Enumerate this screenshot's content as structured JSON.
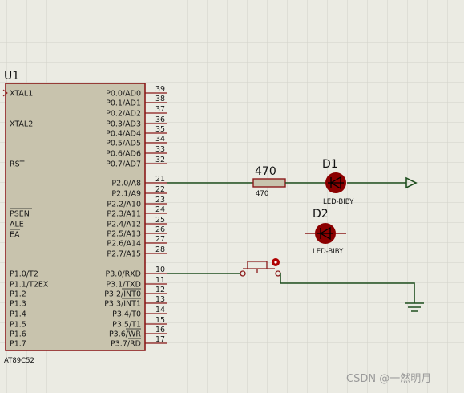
{
  "chip": {
    "ref": "U1",
    "part": "AT89C52",
    "left_pins": [
      "XTAL1",
      "XTAL2",
      "RST",
      "PSEN",
      "ALE",
      "EA",
      "P1.0/T2",
      "P1.1/T2EX",
      "P1.2",
      "P1.3",
      "P1.4",
      "P1.5",
      "P1.6",
      "P1.7"
    ],
    "right_pins": [
      "P0.0/AD0",
      "P0.1/AD1",
      "P0.2/AD2",
      "P0.3/AD3",
      "P0.4/AD4",
      "P0.5/AD5",
      "P0.6/AD6",
      "P0.7/AD7",
      "P2.0/A8",
      "P2.1/A9",
      "P2.2/A10",
      "P2.3/A11",
      "P2.4/A12",
      "P2.5/A13",
      "P2.6/A14",
      "P2.7/A15",
      "P3.0/RXD",
      "P3.1/TXD",
      "P3.2/INT0",
      "P3.3/INT1",
      "P3.4/T0",
      "P3.5/T1",
      "P3.6/WR",
      "P3.7/RD"
    ],
    "right_pin_numbers": [
      "39",
      "38",
      "37",
      "36",
      "35",
      "34",
      "33",
      "32",
      "21",
      "22",
      "23",
      "24",
      "25",
      "26",
      "27",
      "28",
      "10",
      "11",
      "12",
      "13",
      "14",
      "15",
      "16",
      "17"
    ]
  },
  "resistor": {
    "value_label": "470",
    "value_sub": "470"
  },
  "led1": {
    "ref": "D1",
    "part": "LED-BIBY"
  },
  "led2": {
    "ref": "D2",
    "part": "LED-BIBY"
  },
  "watermark": "CSDN @一然明月",
  "colors": {
    "background": "#ebebe3",
    "grid": "#d2d2c8",
    "chip_fill": "#c8c3ad",
    "chip_border": "#8b1a1a",
    "wire": "#1f4f1f",
    "led_fill": "#8b0000"
  }
}
